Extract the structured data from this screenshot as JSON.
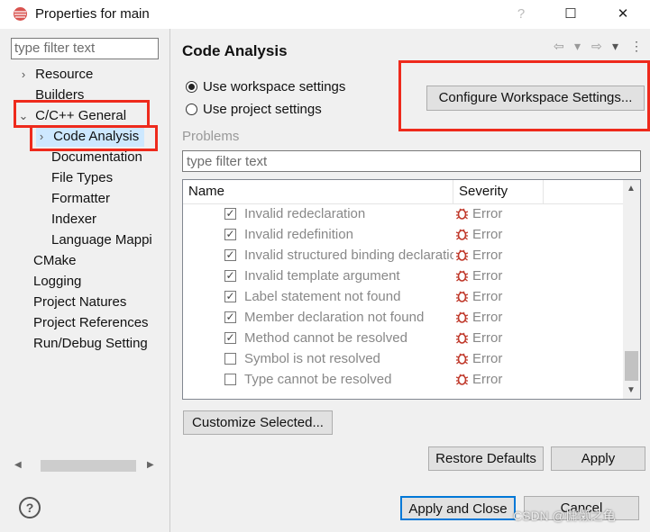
{
  "window": {
    "title": "Properties for main",
    "help_label": "?",
    "maximize_label": "☐",
    "close_label": "✕"
  },
  "left": {
    "filter_placeholder": "type filter text",
    "tree": [
      {
        "label": "Resource",
        "expander": "›"
      },
      {
        "label": "Builders",
        "expander": ""
      },
      {
        "label": "C/C++ General",
        "expander": "⌄"
      },
      {
        "label": "Code Analysis",
        "expander": "›"
      },
      {
        "label": "Documentation",
        "expander": ""
      },
      {
        "label": "File Types",
        "expander": ""
      },
      {
        "label": "Formatter",
        "expander": ""
      },
      {
        "label": "Indexer",
        "expander": ""
      },
      {
        "label": "Language Mappi",
        "expander": ""
      },
      {
        "label": "CMake",
        "expander": ""
      },
      {
        "label": "Logging",
        "expander": ""
      },
      {
        "label": "Project Natures",
        "expander": ""
      },
      {
        "label": "Project References",
        "expander": ""
      },
      {
        "label": "Run/Debug Setting",
        "expander": ""
      }
    ],
    "help_icon": "?"
  },
  "right": {
    "title": "Code Analysis",
    "nav": {
      "back": "⇦",
      "back_menu": "▾",
      "forward": "⇨",
      "forward_menu": "▾",
      "menu": "⋮"
    },
    "radio_workspace": "Use workspace settings",
    "radio_project": "Use project settings",
    "configure_button": "Configure Workspace Settings...",
    "problems_label": "Problems",
    "filter_placeholder": "type filter text",
    "table": {
      "col_name": "Name",
      "col_severity": "Severity",
      "rows": [
        {
          "name": "Invalid redeclaration",
          "severity": "Error",
          "checked": true
        },
        {
          "name": "Invalid redefinition",
          "severity": "Error",
          "checked": true
        },
        {
          "name": "Invalid structured binding declaration",
          "severity": "Error",
          "checked": true
        },
        {
          "name": "Invalid template argument",
          "severity": "Error",
          "checked": true
        },
        {
          "name": "Label statement not found",
          "severity": "Error",
          "checked": true
        },
        {
          "name": "Member declaration not found",
          "severity": "Error",
          "checked": true
        },
        {
          "name": "Method cannot be resolved",
          "severity": "Error",
          "checked": true
        },
        {
          "name": "Symbol is not resolved",
          "severity": "Error",
          "checked": false
        },
        {
          "name": "Type cannot be resolved",
          "severity": "Error",
          "checked": false
        }
      ]
    },
    "customize_button": "Customize Selected...",
    "restore_button": "Restore Defaults",
    "apply_button": "Apply",
    "apply_close_button": "Apply and Close",
    "cancel_button": "Cancel"
  },
  "watermark": "CSDN @慵懒之龟",
  "colors": {
    "highlight_box": "#ee2a1c",
    "selection": "#cde8ff",
    "error_icon": "#c0392b"
  }
}
